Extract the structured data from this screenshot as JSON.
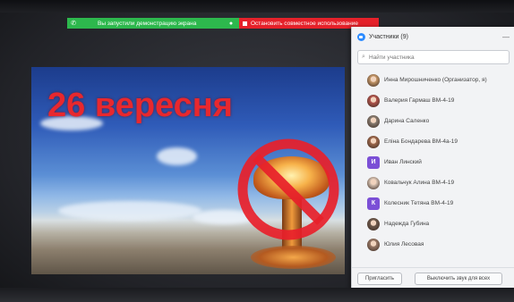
{
  "share_toolbar": {
    "status_text": "Вы запустили демонстрацию экрана",
    "stop_label": "Остановить совместное использование",
    "green_color": "#2db84d",
    "red_color": "#e5212a"
  },
  "slide": {
    "title": "26 вересня",
    "title_color": "#e8282e"
  },
  "participants_panel": {
    "title": "Участники (9)",
    "minimize_glyph": "—",
    "search_placeholder": "Найти участника",
    "participants": [
      {
        "name": "Инна Мирошниченко (Организатор, я)",
        "avatar": "photo",
        "initial": "",
        "color": "#c89a6a"
      },
      {
        "name": "Валерия Гармаш ВМ-4-19",
        "avatar": "photo",
        "initial": "",
        "color": "#b5564e"
      },
      {
        "name": "Дарина Саленко",
        "avatar": "photo",
        "initial": "",
        "color": "#8b7f73"
      },
      {
        "name": "Еліна Бондарева ВМ-4а-19",
        "avatar": "photo",
        "initial": "",
        "color": "#a06a4d"
      },
      {
        "name": "Иван Линский",
        "avatar": "letter",
        "initial": "И",
        "color": "#7b4fd6"
      },
      {
        "name": "Ковальчук Алина ВМ-4-19",
        "avatar": "photo",
        "initial": "",
        "color": "#d9c4b3"
      },
      {
        "name": "Колесник Тетяна ВМ-4-19",
        "avatar": "letter",
        "initial": "К",
        "color": "#7b4fd6"
      },
      {
        "name": "Надежда Губина",
        "avatar": "photo",
        "initial": "",
        "color": "#6f5a4c"
      },
      {
        "name": "Юлия Лесовая",
        "avatar": "photo",
        "initial": "",
        "color": "#9c7b68"
      }
    ],
    "invite_label": "Пригласить",
    "mute_all_label": "Выключить звук для всех"
  }
}
